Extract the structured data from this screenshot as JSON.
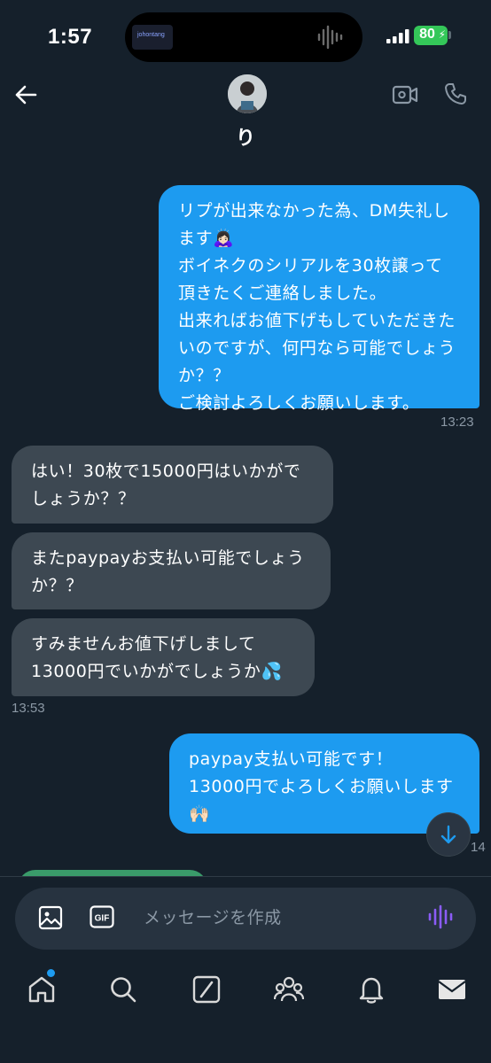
{
  "status_bar": {
    "time": "1:57",
    "battery": "80",
    "island_thumb_text": "johontang"
  },
  "header": {
    "contact_name": "り"
  },
  "messages": [
    {
      "direction": "out",
      "text": "リプが出来なかった為、DM失礼し\nます🙇🏻‍♀️\nボイネクのシリアルを30枚譲って\n頂きたくご連絡しました。\n出来ればお値下げもしていただきた\nいのですが、何円なら可能でしょう\nか？？\nご検討よろしくお願いします。"
    },
    {
      "direction": "in",
      "text": "はい！30枚で15000円はいかがで\nしょうか？？"
    },
    {
      "direction": "in",
      "text": "またpaypayお支払い可能でしょう\nか？？"
    },
    {
      "direction": "in",
      "text": "すみませんお値下げしまして\n13000円でいかがでしょうか💦"
    },
    {
      "direction": "out",
      "text": "paypay支払い可能です！\n13000円でよろしくお願いします\n🙌🏻"
    }
  ],
  "timestamps": {
    "first_out": "13:23",
    "incoming": "13:53",
    "second_out_partial": "14"
  },
  "composer": {
    "placeholder": "メッセージを作成",
    "gif_label": "GIF"
  },
  "colors": {
    "background": "#15202b",
    "outgoing_bubble": "#1d9bf0",
    "incoming_bubble": "#3d4852",
    "timestamp": "#8b98a5",
    "battery": "#34c759",
    "voice_icon": "#8b5cf6"
  },
  "icons": {
    "back": "arrow-left-icon",
    "video": "video-camera-icon",
    "phone": "phone-icon",
    "image": "image-icon",
    "gif": "gif-icon",
    "voice": "voice-wave-icon",
    "scroll": "arrow-down-icon",
    "tabs": [
      "home-icon",
      "search-icon",
      "grok-icon",
      "communities-icon",
      "notifications-icon",
      "messages-icon"
    ]
  }
}
